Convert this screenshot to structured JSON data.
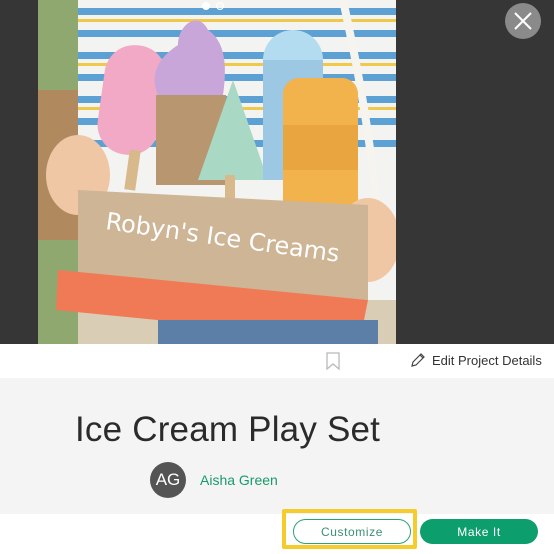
{
  "gallery": {
    "image_alt": "Ice cream stand craft held by a child",
    "box_caption": "Robyn's Ice Creams",
    "dots": [
      "active",
      "inactive"
    ]
  },
  "actions": {
    "edit_label": "Edit Project Details"
  },
  "project": {
    "title": "Ice Cream Play Set",
    "author_initials": "AG",
    "author_name": "Aisha Green"
  },
  "footer": {
    "customize_label": "Customize",
    "make_it_label": "Make It"
  },
  "colors": {
    "accent": "#0c9e6c",
    "highlight": "#f5cc2b",
    "hero_bg": "#363636"
  },
  "icons": {
    "close": "close-icon",
    "bookmark": "bookmark-icon",
    "edit": "pencil-icon"
  }
}
